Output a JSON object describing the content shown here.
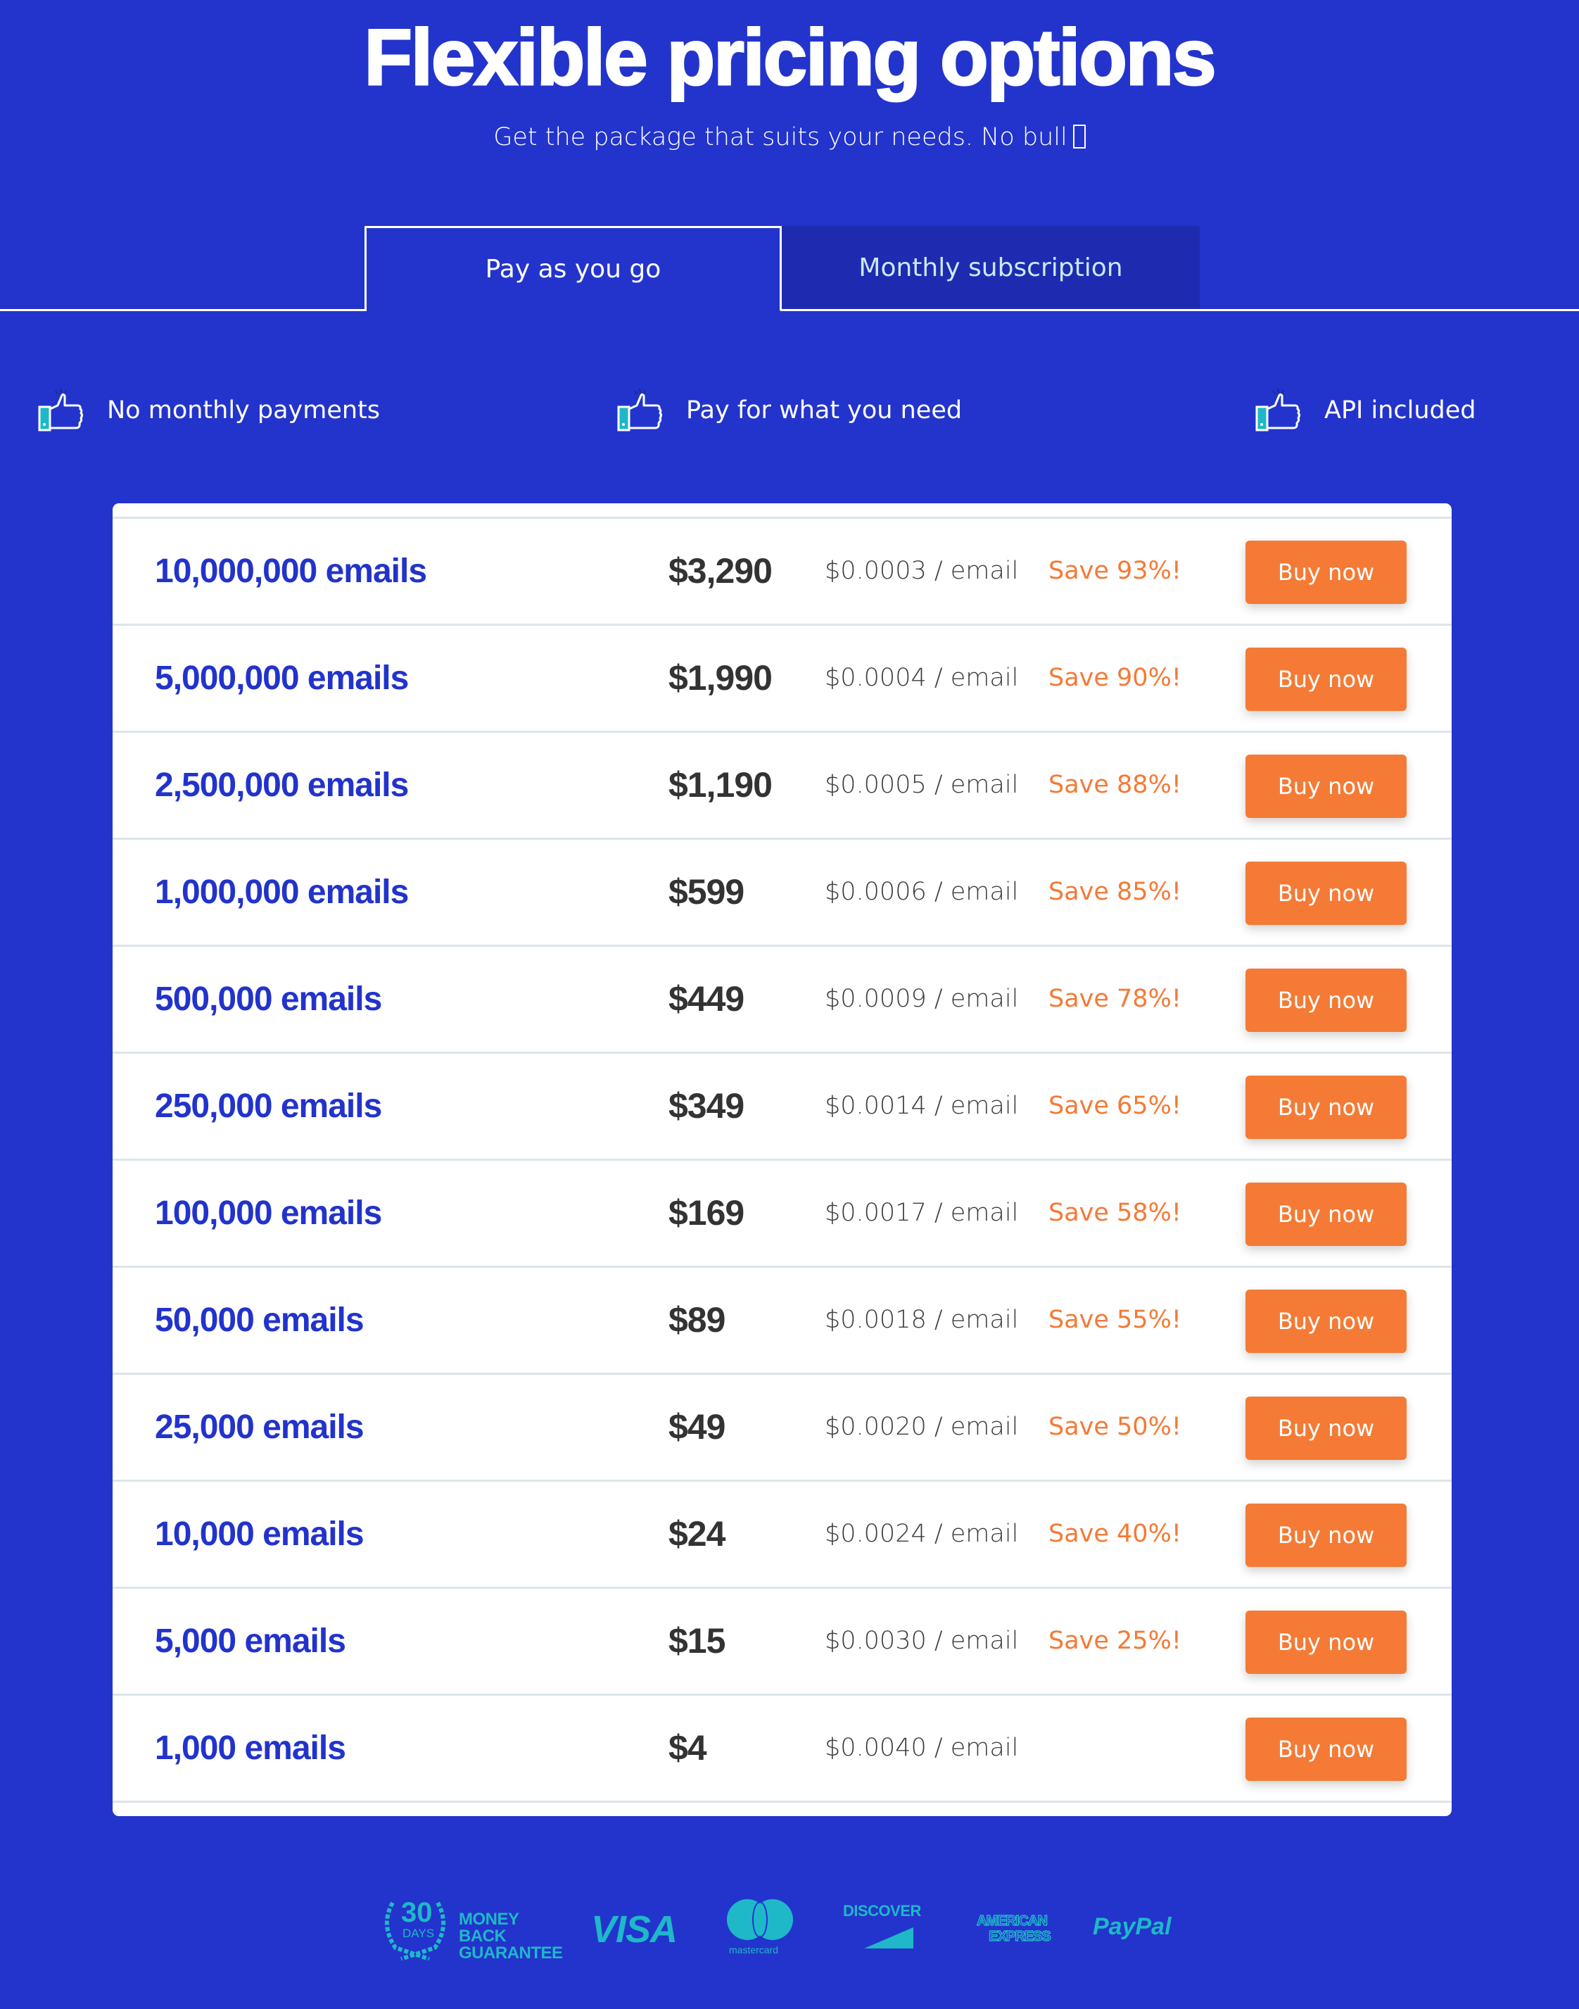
{
  "header": {
    "title": "Flexible pricing options",
    "subtitle": "Get the package that suits your needs. No bull"
  },
  "tabs": [
    {
      "label": "Pay as you go",
      "active": true
    },
    {
      "label": "Monthly subscription",
      "active": false
    }
  ],
  "features": [
    {
      "icon": "thumbs-up-icon",
      "label": "No monthly payments"
    },
    {
      "icon": "thumbs-up-icon",
      "label": "Pay for what you need"
    },
    {
      "icon": "thumbs-up-icon",
      "label": "API included"
    }
  ],
  "colors": {
    "background": "#2334cc",
    "accent_orange": "#f57a35",
    "quantity_blue": "#2233cc",
    "logo_teal": "#1fb8c8",
    "inactive_tab": "#1e2bb1"
  },
  "pricing": {
    "buy_label": "Buy now",
    "rows": [
      {
        "quantity": "10,000,000 emails",
        "price": "$3,290",
        "per_email": "$0.0003 / email",
        "save": "Save 93%!"
      },
      {
        "quantity": "5,000,000 emails",
        "price": "$1,990",
        "per_email": "$0.0004 / email",
        "save": "Save 90%!"
      },
      {
        "quantity": "2,500,000 emails",
        "price": "$1,190",
        "per_email": "$0.0005 / email",
        "save": "Save 88%!"
      },
      {
        "quantity": "1,000,000 emails",
        "price": "$599",
        "per_email": "$0.0006 / email",
        "save": "Save 85%!"
      },
      {
        "quantity": "500,000 emails",
        "price": "$449",
        "per_email": "$0.0009 / email",
        "save": "Save 78%!"
      },
      {
        "quantity": "250,000 emails",
        "price": "$349",
        "per_email": "$0.0014 / email",
        "save": "Save 65%!"
      },
      {
        "quantity": "100,000 emails",
        "price": "$169",
        "per_email": "$0.0017 / email",
        "save": "Save 58%!"
      },
      {
        "quantity": "50,000 emails",
        "price": "$89",
        "per_email": "$0.0018 / email",
        "save": "Save 55%!"
      },
      {
        "quantity": "25,000 emails",
        "price": "$49",
        "per_email": "$0.0020 / email",
        "save": "Save 50%!"
      },
      {
        "quantity": "10,000 emails",
        "price": "$24",
        "per_email": "$0.0024 / email",
        "save": "Save 40%!"
      },
      {
        "quantity": "5,000 emails",
        "price": "$15",
        "per_email": "$0.0030 / email",
        "save": "Save 25%!"
      },
      {
        "quantity": "1,000 emails",
        "price": "$4",
        "per_email": "$0.0040 / email",
        "save": ""
      }
    ]
  },
  "footer": {
    "guarantee": {
      "days": "30",
      "days_label": "DAYS",
      "line1": "MONEY BACK",
      "line2": "GUARANTEE"
    },
    "payment_logos": {
      "visa": "VISA",
      "mastercard": "mastercard",
      "discover": "DISCOVER",
      "amex_line1": "AMERICAN",
      "amex_line2": "EXPRESS",
      "paypal": "PayPal"
    }
  }
}
